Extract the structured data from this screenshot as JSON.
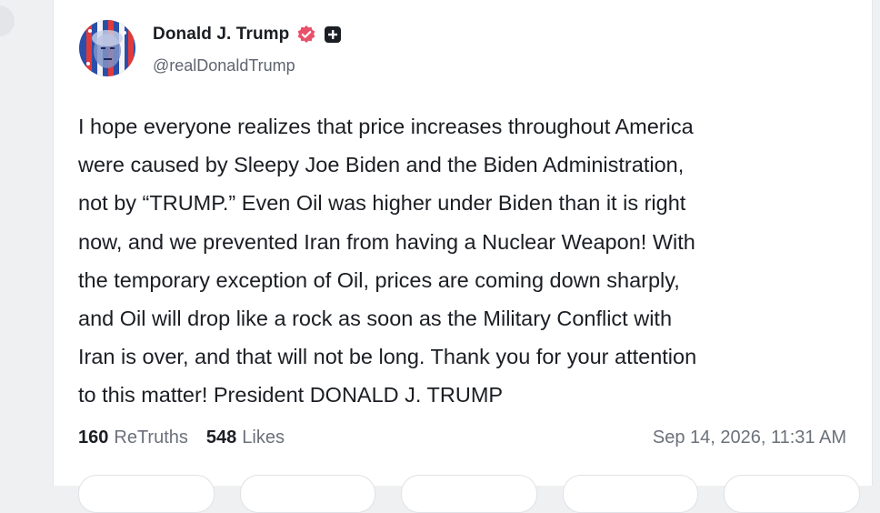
{
  "post": {
    "author": {
      "display_name": "Donald J. Trump",
      "handle": "@realDonaldTrump",
      "verified": true,
      "badge_icon": "verified-badge-icon",
      "extra_icon": "plus-square-icon",
      "verified_color": "#e8506a"
    },
    "text": "I hope everyone realizes that price increases throughout America\nwere caused by Sleepy Joe Biden and the Biden Administration,\nnot by “TRUMP.” Even Oil was higher under Biden than it is right\nnow, and we prevented Iran from having a Nuclear Weapon! With\nthe temporary exception of Oil, prices are coming down sharply,\nand Oil will drop like a rock as soon as the Military Conflict with\nIran is over, and that will not be long. Thank you for your attention\nto this matter! President DONALD J. TRUMP",
    "stats": {
      "retruths_count": "160",
      "retruths_label": "ReTruths",
      "likes_count": "548",
      "likes_label": "Likes"
    },
    "timestamp": "Sep 14, 2026, 11:31 AM"
  }
}
